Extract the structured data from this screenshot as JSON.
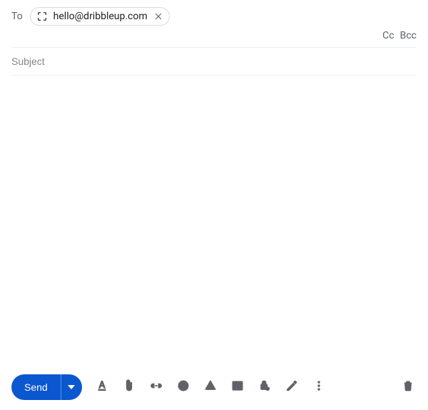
{
  "to": {
    "label": "To",
    "recipients": [
      {
        "email": "hello@dribbleup.com"
      }
    ],
    "cc_label": "Cc",
    "bcc_label": "Bcc"
  },
  "subject": {
    "placeholder": "Subject",
    "value": ""
  },
  "body": {
    "value": ""
  },
  "toolbar": {
    "send_label": "Send"
  }
}
